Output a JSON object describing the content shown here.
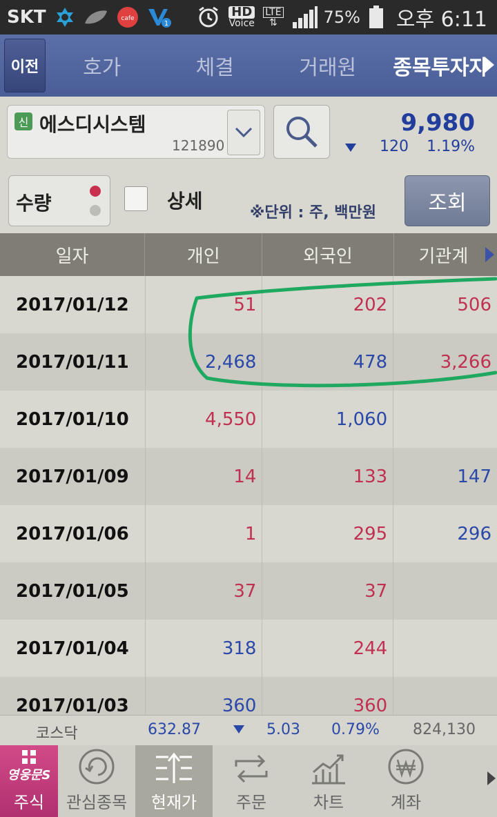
{
  "status_bar": {
    "carrier": "SKT",
    "hd_label": "HD",
    "voice_label": "Voice",
    "lte_label": "LTE",
    "battery": "75%",
    "time": "오후 6:11"
  },
  "tabs": {
    "prev": "이전",
    "items": [
      "호가",
      "체결",
      "거래원",
      "종목투자자"
    ],
    "active": 3
  },
  "stock": {
    "badge": "신",
    "name": "에스디시스템",
    "code": "121890",
    "price": "9,980",
    "change": "120",
    "change_pct": "1.19%",
    "direction": "down"
  },
  "options": {
    "qty_label": "수량",
    "detail_label": "상세",
    "unit_note": "※단위 : 주, 백만원",
    "query_button": "조회"
  },
  "table": {
    "headers": [
      "일자",
      "개인",
      "외국인",
      "기관계"
    ],
    "rows": [
      {
        "date": "2017/01/12",
        "individual": "51",
        "ind_color": "red",
        "foreign": "202",
        "for_color": "red",
        "institution": "506",
        "inst_color": "red"
      },
      {
        "date": "2017/01/11",
        "individual": "2,468",
        "ind_color": "blue",
        "foreign": "478",
        "for_color": "blue",
        "institution": "3,266",
        "inst_color": "red"
      },
      {
        "date": "2017/01/10",
        "individual": "4,550",
        "ind_color": "red",
        "foreign": "1,060",
        "for_color": "blue",
        "institution": "",
        "inst_color": "red"
      },
      {
        "date": "2017/01/09",
        "individual": "14",
        "ind_color": "red",
        "foreign": "133",
        "for_color": "red",
        "institution": "147",
        "inst_color": "blue"
      },
      {
        "date": "2017/01/06",
        "individual": "1",
        "ind_color": "red",
        "foreign": "295",
        "for_color": "red",
        "institution": "296",
        "inst_color": "blue"
      },
      {
        "date": "2017/01/05",
        "individual": "37",
        "ind_color": "red",
        "foreign": "37",
        "for_color": "red",
        "institution": "",
        "inst_color": "red"
      },
      {
        "date": "2017/01/04",
        "individual": "318",
        "ind_color": "blue",
        "foreign": "244",
        "for_color": "red",
        "institution": "",
        "inst_color": "red"
      },
      {
        "date": "2017/01/03",
        "individual": "360",
        "ind_color": "blue",
        "foreign": "360",
        "for_color": "red",
        "institution": "",
        "inst_color": "red"
      }
    ]
  },
  "index_bar": {
    "name": "코스닥",
    "value": "632.87",
    "change": "5.03",
    "change_pct": "0.79%",
    "volume": "824,130"
  },
  "bottom_nav": {
    "brand_text": "영웅문S",
    "items": [
      "주식",
      "관심종목",
      "현재가",
      "주문",
      "차트",
      "계좌"
    ],
    "current": 2
  },
  "colors": {
    "up": "#c03050",
    "down": "#2a48a8",
    "tab_bar": "#4a5d96",
    "annotation": "#1fa860"
  }
}
